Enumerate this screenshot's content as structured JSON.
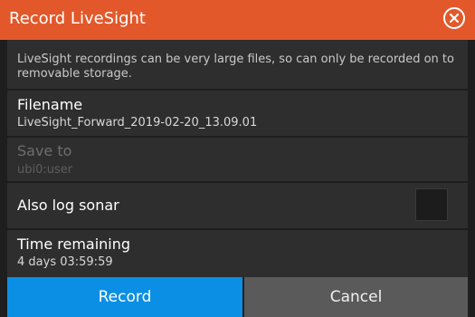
{
  "dialog": {
    "title": "Record LiveSight",
    "close_icon": "close-circle-icon",
    "info_text": "LiveSight recordings can be very large files, so can only be recorded on to removable storage."
  },
  "filename": {
    "label": "Filename",
    "value": "LiveSight_Forward_2019-02-20_13.09.01"
  },
  "save_to": {
    "label": "Save to",
    "value": "ubi0:user",
    "enabled": false
  },
  "also_log_sonar": {
    "label": "Also log sonar",
    "checked": false
  },
  "time_remaining": {
    "label": "Time remaining",
    "value": "4 days 03:59:59"
  },
  "buttons": {
    "record_label": "Record",
    "cancel_label": "Cancel"
  },
  "colors": {
    "title_bar": "#e2582a",
    "record_button": "#0a8fe5",
    "cancel_button": "#5a5a5a",
    "panel": "#2e2e2e"
  }
}
